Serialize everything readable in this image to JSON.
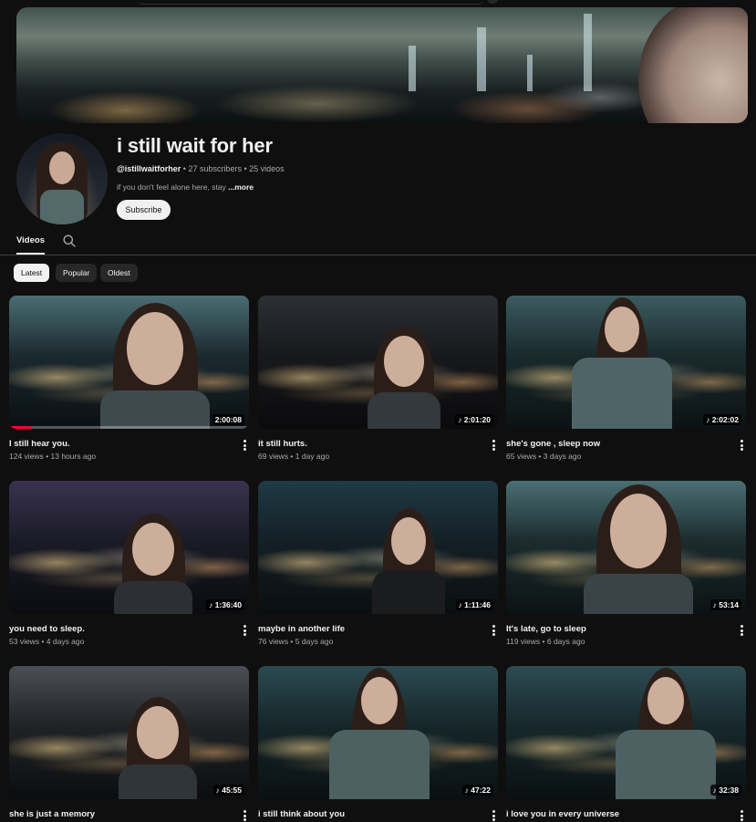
{
  "channel": {
    "title": "i still wait for her",
    "handle": "@istillwaitforher",
    "subscribers": "27 subscribers",
    "video_count": "25 videos",
    "separator": " • ",
    "description": "if you don't feel alone here, stay ",
    "more_label": "...more",
    "subscribe_label": "Subscribe"
  },
  "tabs": {
    "videos_label": "Videos",
    "search_icon": "search-icon"
  },
  "filters": [
    {
      "label": "Latest",
      "active": true
    },
    {
      "label": "Popular",
      "active": false
    },
    {
      "label": "Oldest",
      "active": false
    }
  ],
  "videos": [
    {
      "title": "I still hear you.",
      "views": "124 views",
      "age": "13 hours ago",
      "duration": "2:00:08",
      "short_icon": false,
      "watch_progress": 0.09
    },
    {
      "title": "it still hurts.",
      "views": "69 views",
      "age": "1 day ago",
      "duration": "2:01:20",
      "short_icon": true
    },
    {
      "title": "she's gone , sleep now",
      "views": "65 views",
      "age": "3 days ago",
      "duration": "2:02:02",
      "short_icon": true
    },
    {
      "title": "you need to sleep.",
      "views": "53 views",
      "age": "4 days ago",
      "duration": "1:36:40",
      "short_icon": true
    },
    {
      "title": "maybe in another life",
      "views": "76 views",
      "age": "5 days ago",
      "duration": "1:11:46",
      "short_icon": true
    },
    {
      "title": "It's late, go to sleep",
      "views": "119 views",
      "age": "6 days ago",
      "duration": "53:14",
      "short_icon": true
    },
    {
      "title": "she is just a memory",
      "views": "",
      "age": "",
      "duration": "45:55",
      "short_icon": true
    },
    {
      "title": "i still think about you",
      "views": "",
      "age": "",
      "duration": "47:22",
      "short_icon": true
    },
    {
      "title": "i love you in every universe",
      "views": "",
      "age": "",
      "duration": "32:38",
      "short_icon": true
    }
  ],
  "colors": {
    "background": "#0f0f0f",
    "text": "#f1f1f1",
    "muted": "#aaaaaa",
    "progress": "#ff0033",
    "chip_inactive": "#272727"
  }
}
